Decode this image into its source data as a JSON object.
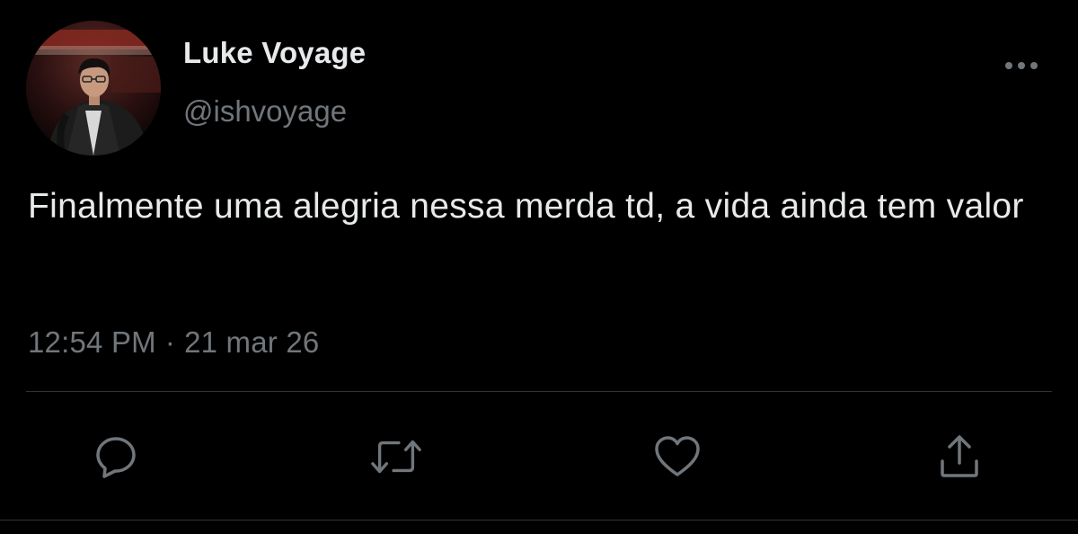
{
  "tweet": {
    "author": {
      "display_name": "Luke Voyage",
      "handle": "@ishvoyage",
      "avatar_icon": "profile-photo"
    },
    "text": "Finalmente uma alegria nessa merda td, a vida ainda tem valor",
    "time": "12:54 PM",
    "separator": "·",
    "date": "21 mar 26"
  },
  "actions": {
    "reply_icon": "reply-icon",
    "retweet_icon": "retweet-icon",
    "like_icon": "heart-icon",
    "share_icon": "share-icon",
    "more_icon": "more-icon"
  },
  "colors": {
    "background": "#000000",
    "text_primary": "#e7e9ea",
    "text_secondary": "#71767b",
    "divider": "#2f3336"
  }
}
